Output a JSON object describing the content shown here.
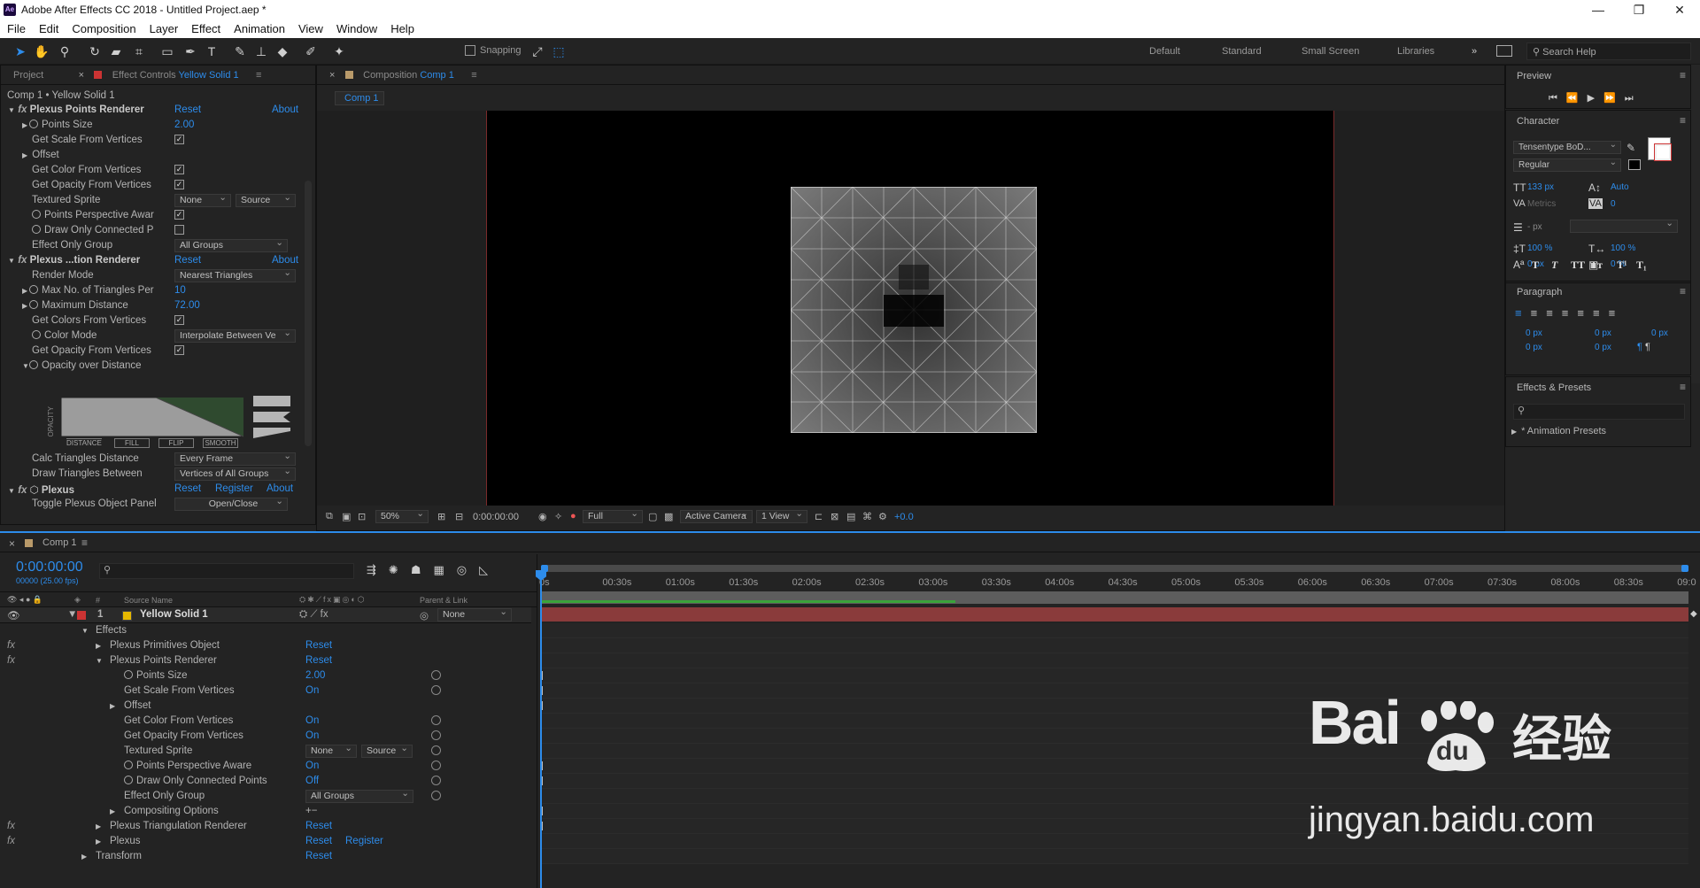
{
  "window": {
    "title": "Adobe After Effects CC 2018 - Untitled Project.aep *",
    "app_badge": "Ae"
  },
  "menu": [
    "File",
    "Edit",
    "Composition",
    "Layer",
    "Effect",
    "Animation",
    "View",
    "Window",
    "Help"
  ],
  "toolbar": {
    "snapping": "Snapping",
    "workspaces": [
      "Default",
      "Standard",
      "Small Screen",
      "Libraries"
    ],
    "search_placeholder": "Search Help"
  },
  "effect_controls": {
    "tab_project": "Project",
    "tab_label": "Effect Controls",
    "tab_layer": "Yellow Solid 1",
    "breadcrumb": "Comp 1 • Yellow Solid 1",
    "rows": [
      {
        "label": "Plexus Points Renderer",
        "reset": "Reset",
        "about": "About"
      },
      {
        "label": "Points Size",
        "value": "2.00"
      },
      {
        "label": "Get Scale From Vertices",
        "check": "✓"
      },
      {
        "label": "Offset"
      },
      {
        "label": "Get Color From Vertices",
        "check": "✓"
      },
      {
        "label": "Get Opacity From Vertices",
        "check": "✓"
      },
      {
        "label": "Textured Sprite",
        "dd1": "None",
        "dd2": "Source"
      },
      {
        "label": "Points Perspective Awar",
        "check": "✓"
      },
      {
        "label": "Draw Only Connected P",
        "check": ""
      },
      {
        "label": "Effect Only Group",
        "dd1": "All Groups"
      },
      {
        "label": "Plexus ...tion Renderer",
        "reset": "Reset",
        "about": "About"
      },
      {
        "label": "Render Mode",
        "dd1": "Nearest Triangles"
      },
      {
        "label": "Max No. of Triangles Per",
        "value": "10"
      },
      {
        "label": "Maximum Distance",
        "value": "72.00"
      },
      {
        "label": "Get Colors From Vertices",
        "check": "✓"
      },
      {
        "label": "Color Mode",
        "dd1": "Interpolate Between Ve"
      },
      {
        "label": "Get Opacity From Vertices",
        "check": "✓"
      },
      {
        "label": "Opacity over Distance"
      },
      {
        "label": "Calc Triangles Distance",
        "dd1": "Every Frame"
      },
      {
        "label": "Draw Triangles Between",
        "dd1": "Vertices of All Groups"
      },
      {
        "label": "Plexus",
        "reset": "Reset",
        "register": "Register",
        "about": "About"
      },
      {
        "label": "Toggle Plexus Object Panel",
        "button": "Open/Close"
      }
    ],
    "graph": {
      "y_label": "OPACITY",
      "buttons": [
        "DISTANCE",
        "FILL",
        "FLIP",
        "SMOOTH"
      ]
    }
  },
  "composition": {
    "tab_label": "Composition",
    "tab_comp": "Comp 1",
    "subtab": "Comp 1",
    "footer": {
      "zoom": "50%",
      "timecode": "0:00:00:00",
      "resolution": "Full",
      "camera": "Active Camera",
      "views": "1 View",
      "exposure": "+0.0"
    }
  },
  "right_panel": {
    "preview": "Preview",
    "character": "Character",
    "font": "Tensentype BoD...",
    "style": "Regular",
    "size": "133 px",
    "leading": "Auto",
    "kerning": "Metrics",
    "tracking": "0",
    "stroke": "- px",
    "vscale": "100 %",
    "hscale": "100 %",
    "baseline": "0 px",
    "tsume": "0 %",
    "text_styles": [
      "T",
      "T",
      "TT",
      "Tт",
      "T¹",
      "T₁"
    ],
    "paragraph": "Paragraph",
    "indents": [
      "0 px",
      "0 px",
      "0 px",
      "0 px",
      "0 px"
    ],
    "effects_presets": "Effects & Presets",
    "animation_presets": "* Animation Presets"
  },
  "timeline": {
    "tab": "Comp 1",
    "timecode": "0:00:00:00",
    "fps": "00000 (25.00 fps)",
    "headers": {
      "num": "#",
      "source": "Source Name",
      "parent": "Parent & Link"
    },
    "layer": {
      "num": "1",
      "name": "Yellow Solid 1",
      "parent": "None"
    },
    "ruler": [
      "0s",
      "00:30s",
      "01:00s",
      "01:30s",
      "02:00s",
      "02:30s",
      "03:00s",
      "03:30s",
      "04:00s",
      "04:30s",
      "05:00s",
      "05:30s",
      "06:00s",
      "06:30s",
      "07:00s",
      "07:30s",
      "08:00s",
      "08:30s",
      "09:0"
    ],
    "rows": [
      {
        "label": "Effects"
      },
      {
        "label": "Plexus Primitives Object",
        "value": "Reset",
        "fx": true
      },
      {
        "label": "Plexus Points Renderer",
        "value": "Reset",
        "fx": true
      },
      {
        "label": "Points Size",
        "value": "2.00"
      },
      {
        "label": "Get Scale From Vertices",
        "value": "On"
      },
      {
        "label": "Offset"
      },
      {
        "label": "Get Color From Vertices",
        "value": "On"
      },
      {
        "label": "Get Opacity From Vertices",
        "value": "On"
      },
      {
        "label": "Textured Sprite",
        "dd1": "None",
        "dd2": "Source"
      },
      {
        "label": "Points Perspective Aware",
        "value": "On"
      },
      {
        "label": "Draw Only Connected Points",
        "value": "Off"
      },
      {
        "label": "Effect Only Group",
        "dd1": "All Groups"
      },
      {
        "label": "Compositing Options",
        "value": "+−"
      },
      {
        "label": "Plexus Triangulation Renderer",
        "value": "Reset",
        "fx": true
      },
      {
        "label": "Plexus",
        "value": "Reset",
        "extra": "Register",
        "fx": true
      },
      {
        "label": "Transform",
        "value": "Reset"
      }
    ]
  },
  "watermark": {
    "logo": "Bai",
    "paw": "du",
    "cn": "经验",
    "url": "jingyan.baidu.com"
  }
}
